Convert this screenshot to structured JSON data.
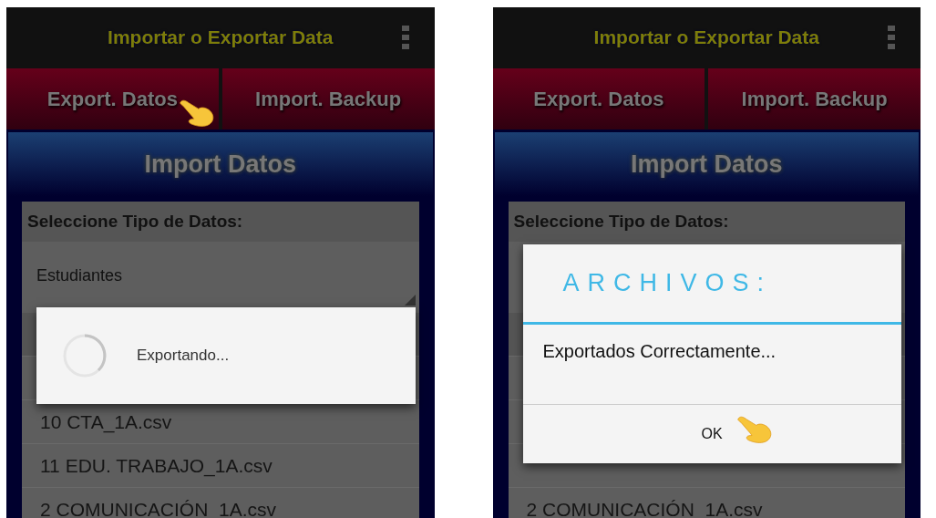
{
  "screens": [
    {
      "title": "Importar o Exportar Data",
      "tabs": [
        {
          "label": "Export. Datos",
          "pointed": true
        },
        {
          "label": "Import. Backup",
          "pointed": false
        }
      ],
      "banner": "Import Datos",
      "section_label": "Seleccione Tipo de Datos:",
      "spinner_value": "Estudiantes",
      "rows": [
        "10 CTA_1A.csv",
        "11 EDU. TRABAJO_1A.csv",
        "2 COMUNICACIÓN_1A.csv"
      ],
      "dialog": {
        "kind": "progress",
        "message": "Exportando..."
      }
    },
    {
      "title": "Importar o Exportar Data",
      "tabs": [
        {
          "label": "Export. Datos",
          "pointed": false
        },
        {
          "label": "Import. Backup",
          "pointed": false
        }
      ],
      "banner": "Import Datos",
      "section_label": "Seleccione Tipo de Datos:",
      "rows": [
        "2 COMUNICACIÓN_1A.csv"
      ],
      "dialog": {
        "kind": "alert",
        "title": "ARCHIVOS:",
        "message": "Exportados Correctamente...",
        "button": "OK",
        "button_pointed": true
      }
    }
  ]
}
